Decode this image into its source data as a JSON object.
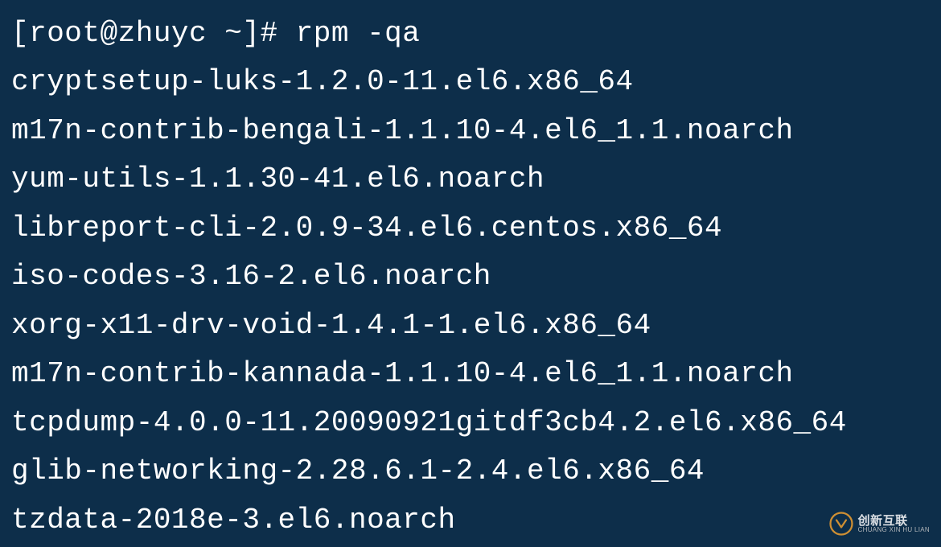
{
  "terminal": {
    "prompt": "[root@zhuyc ~]# ",
    "command": "rpm -qa",
    "output": [
      "cryptsetup-luks-1.2.0-11.el6.x86_64",
      "m17n-contrib-bengali-1.1.10-4.el6_1.1.noarch",
      "yum-utils-1.1.30-41.el6.noarch",
      "libreport-cli-2.0.9-34.el6.centos.x86_64",
      "iso-codes-3.16-2.el6.noarch",
      "xorg-x11-drv-void-1.4.1-1.el6.x86_64",
      "m17n-contrib-kannada-1.1.10-4.el6_1.1.noarch",
      "tcpdump-4.0.0-11.20090921gitdf3cb4.2.el6.x86_64",
      "glib-networking-2.28.6.1-2.4.el6.x86_64",
      "tzdata-2018e-3.el6.noarch"
    ]
  },
  "watermark": {
    "cn": "创新互联",
    "en": "CHUANG XIN HU LIAN"
  }
}
